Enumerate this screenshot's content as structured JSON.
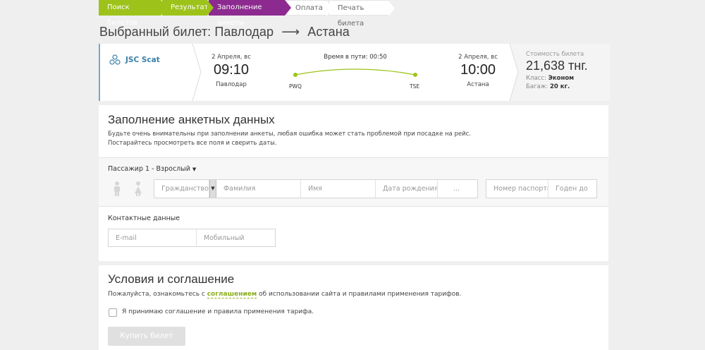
{
  "steps": [
    {
      "label": "Поиск билетов",
      "state": "done"
    },
    {
      "label": "Результат",
      "state": "done"
    },
    {
      "label": "Заполнение анкеты",
      "state": "active"
    },
    {
      "label": "Оплата",
      "state": "todo"
    },
    {
      "label": "Печать билета",
      "state": "todo"
    }
  ],
  "page_title": {
    "prefix": "Выбранный билет:",
    "from": "Павлодар",
    "arrow": "⟶",
    "to": "Астана"
  },
  "ticket": {
    "airline": "JSC Scat",
    "departure": {
      "date": "2 Апреля, вс",
      "time": "09:10",
      "city": "Павлодар",
      "code": "PWQ"
    },
    "arrival": {
      "date": "2 Апреля, вс",
      "time": "10:00",
      "city": "Астана",
      "code": "TSE"
    },
    "duration": "Время в пути: 00:50",
    "price_label": "Стоимость билета",
    "price": "21,638 тнг.",
    "class_label": "Класс:",
    "class_value": "Эконом",
    "baggage_label": "Багаж:",
    "baggage_value": "20 кг."
  },
  "form": {
    "title": "Заполнение анкетных данных",
    "hint_line1": "Будьте очень внимательны при заполнении анкеты, любая ошибка может стать проблемой при посадке на рейс.",
    "hint_line2": "Постарайтесь просмотреть все поля и сверить даты.",
    "passenger_label": "Пассажир 1 - Взрослый",
    "citizenship_placeholder": "Гражданство",
    "lastname_placeholder": "Фамилия",
    "firstname_placeholder": "Имя",
    "birthdate_placeholder": "Дата рождения",
    "extra_placeholder": "...",
    "passport_placeholder": "Номер паспорта",
    "valid_until_placeholder": "Годен до",
    "contacts_label": "Контактные данные",
    "email_placeholder": "E-mail",
    "mobile_placeholder": "Мобильный"
  },
  "terms": {
    "title": "Условия и соглашение",
    "text_before": "Пожалуйста, ознакомьтесь с",
    "link": "соглашением",
    "text_after": "об использовании сайта и правилами применения тарифов.",
    "checkbox_label": "Я принимаю соглашение и правила применения тарифа.",
    "buy_button": "Купить билет"
  },
  "colors": {
    "done": "#9dc31b",
    "active": "#8c2a8f",
    "accent_green": "#9dc31b",
    "airline_blue": "#3a7fa8"
  }
}
